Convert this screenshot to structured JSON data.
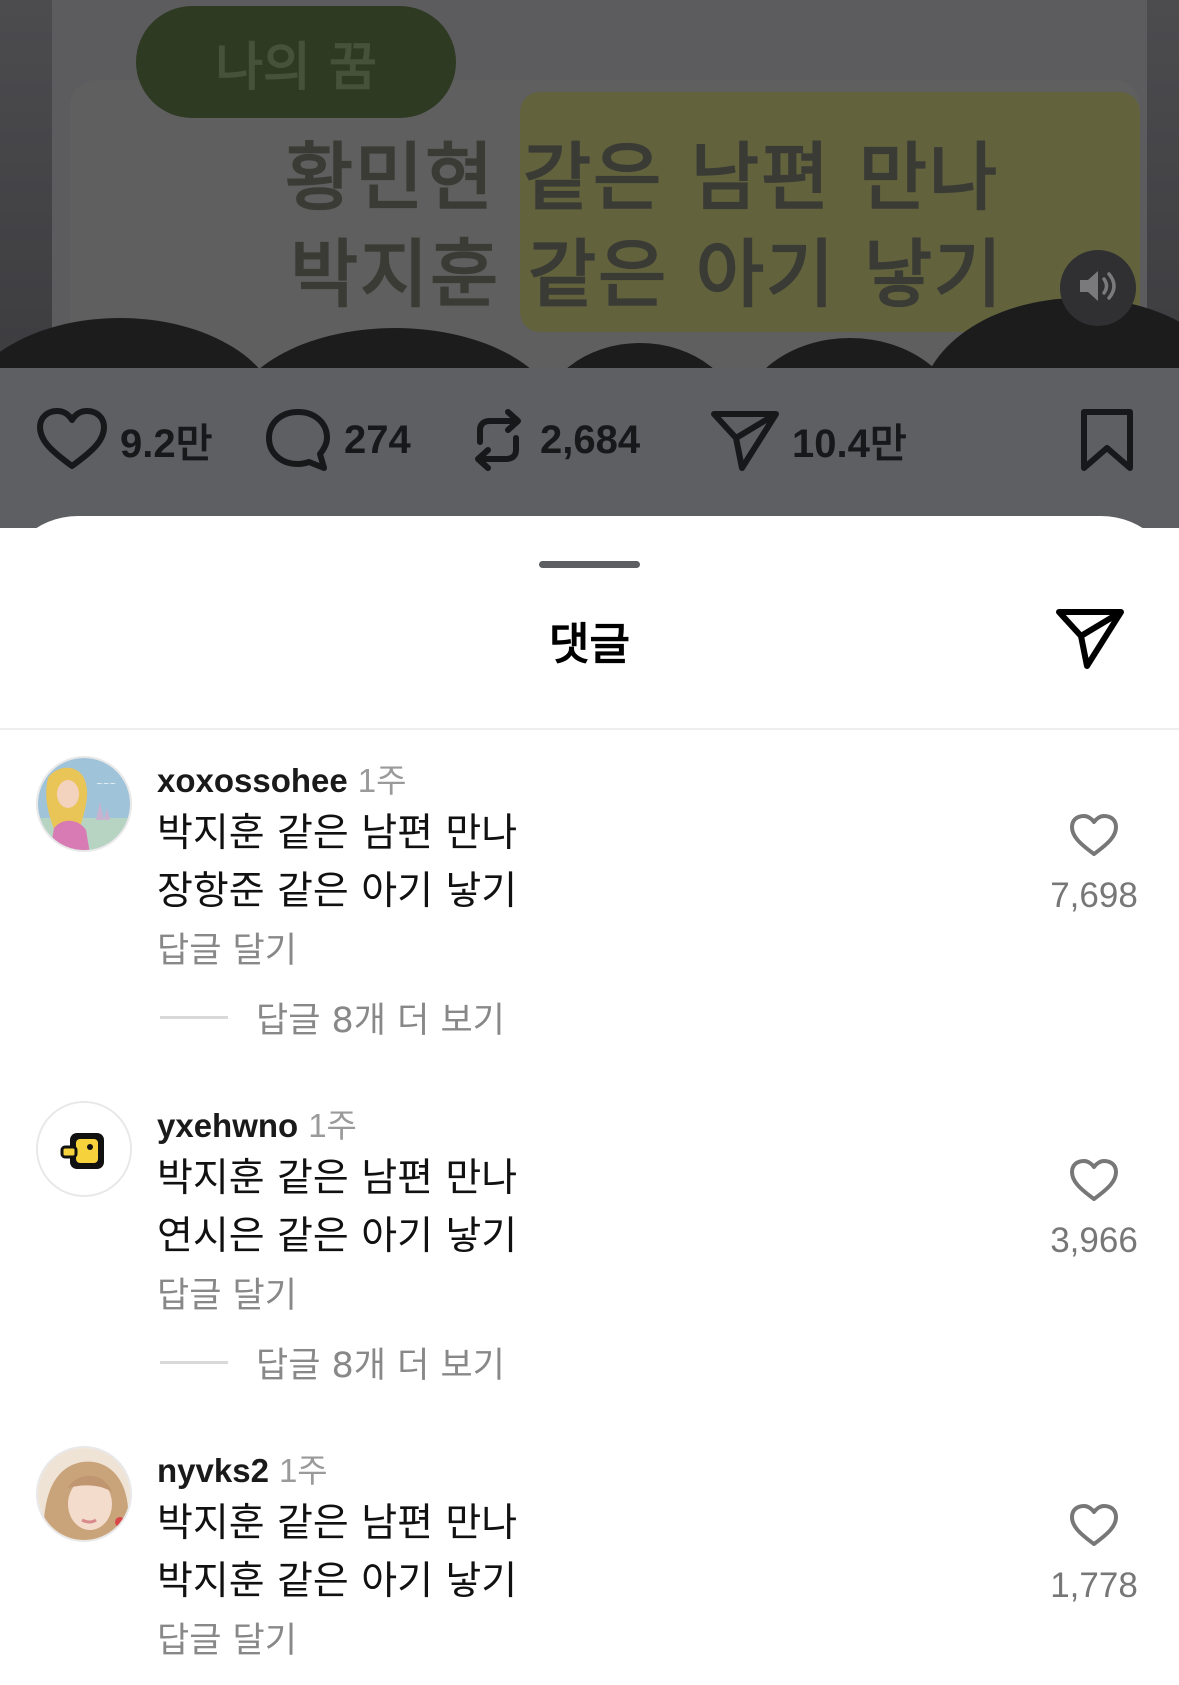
{
  "post": {
    "video": {
      "tag_text": "나의 꿈",
      "line1": "황민현 같은 남편 만나",
      "line2": "박지훈 같은 아기 낳기",
      "volume_icon": "speaker-icon"
    },
    "actions": {
      "likes": "9.2만",
      "comments": "274",
      "reposts": "2,684",
      "shares": "10.4만"
    }
  },
  "sheet": {
    "title": "댓글",
    "comments": [
      {
        "username": "xoxossohee",
        "time": "1주",
        "line1": "박지훈 같은 남편 만나",
        "line2": "장항준 같은 아기 낳기",
        "reply_label": "답글 달기",
        "more_replies": "답글 8개 더 보기",
        "likes": "7,698"
      },
      {
        "username": "yxehwno",
        "time": "1주",
        "line1": "박지훈 같은 남편 만나",
        "line2": "연시은 같은 아기 낳기",
        "reply_label": "답글 달기",
        "more_replies": "답글 8개 더 보기",
        "likes": "3,966"
      },
      {
        "username": "nyvks2",
        "time": "1주",
        "line1": "박지훈 같은 남편 만나",
        "line2": "박지훈 같은 아기 낳기",
        "reply_label": "답글 달기",
        "likes": "1,778"
      }
    ]
  }
}
